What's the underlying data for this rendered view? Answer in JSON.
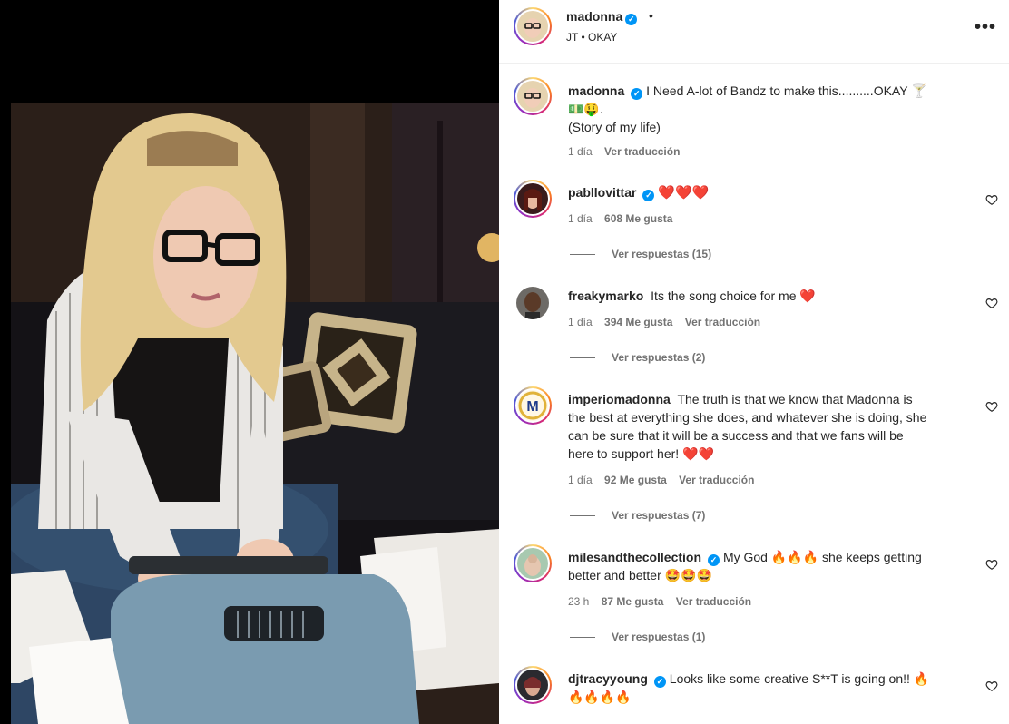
{
  "header": {
    "username": "madonna",
    "separator": "•",
    "audio": "JT • OKAY",
    "more_label": "•••"
  },
  "caption": {
    "username": "madonna",
    "text_line1": "I Need A-lot of Bandz to make this..........OKAY 🍸",
    "text_line2": "💵🤑.",
    "text_line3": "(Story of my life)",
    "time": "1 día",
    "translate": "Ver traducción"
  },
  "comments": [
    {
      "username": "pabllovittar",
      "verified": true,
      "text": "❤️❤️❤️",
      "time": "1 día",
      "likes": "608 Me gusta",
      "translate": "",
      "replies": "Ver respuestas (15)"
    },
    {
      "username": "freakymarko",
      "verified": false,
      "text": "Its the song choice for me ❤️",
      "time": "1 día",
      "likes": "394 Me gusta",
      "translate": "Ver traducción",
      "replies": "Ver respuestas (2)"
    },
    {
      "username": "imperiomadonna",
      "verified": false,
      "text_line1": "The truth is that we know that Madonna is",
      "text_line2": "the best at everything she does, and whatever she is doing, she",
      "text_line3": "can be sure that it will be a success and that we fans will be",
      "text_line4": "here to support her! ❤️❤️",
      "time": "1 día",
      "likes": "92 Me gusta",
      "translate": "Ver traducción",
      "replies": "Ver respuestas (7)"
    },
    {
      "username": "milesandthecollection",
      "verified": true,
      "text_line1": "My God 🔥🔥🔥 she keeps getting",
      "text_line2": "better and better 🤩🤩🤩",
      "time": "23 h",
      "likes": "87 Me gusta",
      "translate": "Ver traducción",
      "replies": "Ver respuestas (1)"
    },
    {
      "username": "djtracyyoung",
      "verified": true,
      "text_line1": "Looks like some creative S**T is going on!! 🔥",
      "text_line2": "🔥🔥🔥🔥"
    }
  ],
  "icons": {
    "verified": "verified-badge-icon",
    "like": "heart-outline-icon",
    "more": "more-horizontal-icon"
  },
  "colors": {
    "verified_blue": "#0095f6",
    "secondary_text": "#737373",
    "heart_red": "#ed0d35"
  }
}
